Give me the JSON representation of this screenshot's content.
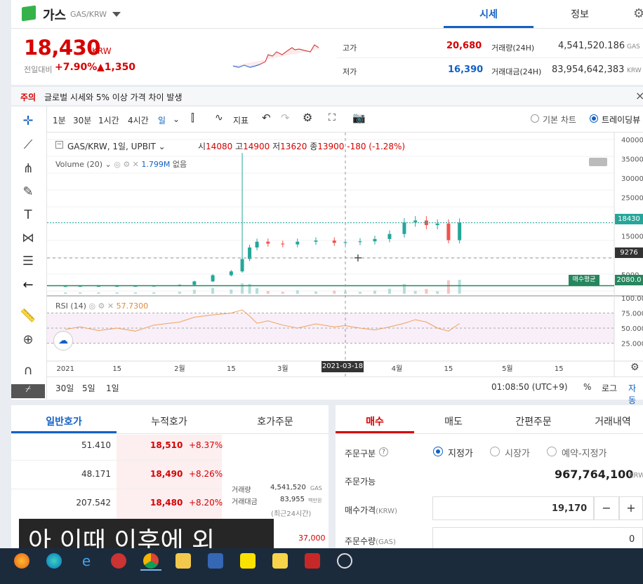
{
  "coin": {
    "name": "가스",
    "pair": "GAS/KRW",
    "price": "18,430",
    "currency": "KRW",
    "change_label": "전일대비",
    "change_pct": "+7.90%",
    "change_amt": "▲1,350"
  },
  "stats": {
    "high_label": "고가",
    "high": "20,680",
    "low_label": "저가",
    "low": "16,390",
    "vol_label": "거래량(24H)",
    "vol": "4,541,520.186",
    "vol_unit": "GAS",
    "amt_label": "거래대금(24H)",
    "amt": "83,954,642,383",
    "amt_unit": "KRW"
  },
  "tabs": {
    "price": "시세",
    "info": "정보"
  },
  "notice": {
    "tag": "주의",
    "text": "글로벌 시세와 5% 이상 가격 차이 발생",
    "close": "×"
  },
  "toolbar": {
    "t1m": "1분",
    "t30m": "30분",
    "t1h": "1시간",
    "t4h": "4시간",
    "day": "일",
    "indicator": "지표",
    "basic_chart": "기본 차트",
    "trading_view": "트레이딩뷰"
  },
  "legend": {
    "symbol": "GAS/KRW, 1일, UPBIT",
    "open_l": "시",
    "open": "14080",
    "high_l": "고",
    "high": "14900",
    "low_l": "저",
    "low": "13620",
    "close_l": "종",
    "close": "13900",
    "chg": "-180 (-1.28%)",
    "volume": "Volume (20)",
    "volume_val": "1.799M",
    "volume_na": "없음",
    "rsi": "RSI (14)",
    "rsi_val": "57.7300"
  },
  "price_axis": [
    "40000",
    "35000",
    "30000",
    "25000",
    "20000",
    "15000",
    "10000",
    "5000"
  ],
  "price_tags": {
    "current": "18430",
    "crosshair": "9276",
    "avg_label": "매수평균",
    "avg": "2080.0"
  },
  "rsi_axis": [
    "100.00",
    "75.000",
    "50.000",
    "25.000"
  ],
  "date_axis": [
    "2021",
    "15",
    "2월",
    "15",
    "3월",
    "15",
    "4월",
    "15",
    "5월",
    "15"
  ],
  "crosshair_date": "2021-03-18",
  "range": {
    "r30": "30일",
    "r5": "5일",
    "r1": "1일",
    "time": "01:08:50 (UTC+9)",
    "pct": "%",
    "log": "로그",
    "auto": "자동"
  },
  "orderbook": {
    "tab1": "일반호가",
    "tab2": "누적호가",
    "tab3": "호가주문",
    "rows": [
      {
        "qty": "51.410",
        "price": "18,510",
        "pct": "+8.37%"
      },
      {
        "qty": "48.171",
        "price": "18,490",
        "pct": "+8.26%"
      },
      {
        "qty": "207.542",
        "price": "18,480",
        "pct": "+8.20%"
      }
    ],
    "info_vol_l": "거래량",
    "info_vol": "4,541,520",
    "info_vol_u": "GAS",
    "info_amt_l": "거래대금",
    "info_amt": "83,955",
    "info_amt_u": "백만원",
    "info_note": "(최근24시간)",
    "partial_price": "37,000"
  },
  "order": {
    "tab_buy": "매수",
    "tab_sell": "매도",
    "tab_easy": "간편주문",
    "tab_hist": "거래내역",
    "type_l": "주문구분",
    "help": "?",
    "limit": "지정가",
    "market": "시장가",
    "reserve": "예약-지정가",
    "avail_l": "주문가능",
    "avail": "967,764,100",
    "avail_u": "KRW",
    "price_l": "매수가격",
    "price_u": "(KRW)",
    "price": "19,170",
    "minus": "−",
    "plus": "+",
    "qty_l": "주문수량",
    "qty_u": "(GAS)",
    "qty": "0"
  },
  "subtitle": "아 이때 이후에 외",
  "chart_data": {
    "type": "candlestick",
    "x": [
      "2021-01-01",
      "2021-01-05",
      "2021-01-10",
      "2021-01-15",
      "2021-01-20",
      "2021-01-25",
      "2021-02-01",
      "2021-02-05",
      "2021-02-10",
      "2021-02-15",
      "2021-02-18",
      "2021-02-20",
      "2021-02-22",
      "2021-02-25",
      "2021-03-01",
      "2021-03-05",
      "2021-03-10",
      "2021-03-15",
      "2021-03-18",
      "2021-03-22",
      "2021-03-26",
      "2021-03-30",
      "2021-04-03",
      "2021-04-06",
      "2021-04-09",
      "2021-04-12",
      "2021-04-15",
      "2021-04-18"
    ],
    "close": [
      1950,
      1970,
      1990,
      2000,
      2010,
      2050,
      2300,
      3200,
      4800,
      5800,
      9000,
      12000,
      13500,
      13000,
      12800,
      13500,
      13800,
      13200,
      13400,
      13600,
      14200,
      15500,
      18500,
      19000,
      17800,
      18200,
      13900,
      18430
    ],
    "y_range": [
      0,
      40000
    ],
    "rsi": [
      48,
      52,
      46,
      50,
      45,
      55,
      60,
      68,
      72,
      75,
      80,
      70,
      58,
      62,
      55,
      50,
      57,
      52,
      54,
      50,
      47,
      52,
      58,
      64,
      60,
      50,
      45,
      57.73
    ],
    "rsi_range": [
      0,
      100
    ]
  },
  "taskbar": [
    "firefox",
    "edge-ie",
    "chrome",
    "explorer",
    "store",
    "kakao",
    "sticky",
    "app",
    "clock"
  ]
}
